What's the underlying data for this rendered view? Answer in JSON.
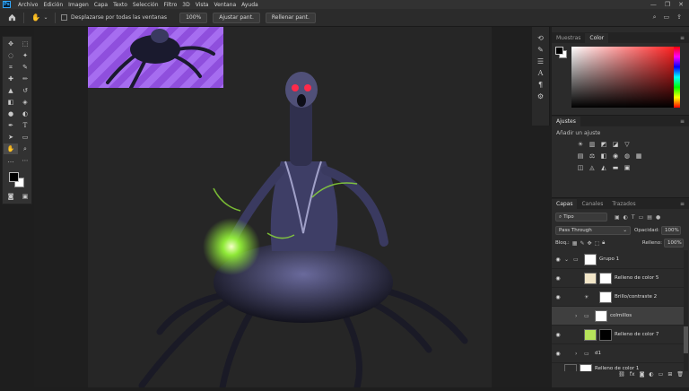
{
  "app": {
    "logo": "Ps"
  },
  "menu": [
    "Archivo",
    "Edición",
    "Imagen",
    "Capa",
    "Texto",
    "Selección",
    "Filtro",
    "3D",
    "Vista",
    "Ventana",
    "Ayuda"
  ],
  "window_controls": [
    "—",
    "❐",
    "✕"
  ],
  "options_bar": {
    "scroll_all_label": "Desplazarse por todas las ventanas",
    "zoom_value": "100%",
    "fit_button": "Ajustar pant.",
    "fill_button": "Rellenar pant."
  },
  "panels": {
    "color_tabs": [
      "Muestras",
      "Color"
    ],
    "adjust_title": "Ajustes",
    "adjust_subtitle": "Añadir un ajuste",
    "layers_tabs": [
      "Capas",
      "Canales",
      "Trazados"
    ],
    "filter_kind": "Tipo",
    "blend_mode": "Pass Through",
    "opacity_label": "Opacidad:",
    "opacity_value": "100%",
    "lock_label": "Bloq.:",
    "fill_label": "Relleno:",
    "fill_value": "100%"
  },
  "layers": [
    {
      "name": "Grupo 1",
      "kind": "group"
    },
    {
      "name": "Relleno de color 5",
      "kind": "fill",
      "thumb": "#f2e6c8"
    },
    {
      "name": "Brillo/contraste 2",
      "kind": "adjust"
    },
    {
      "name": "colmillos",
      "kind": "group",
      "selected": true
    },
    {
      "name": "Relleno de color 7",
      "kind": "fill",
      "thumb": "#b6e35a"
    },
    {
      "name": "d1",
      "kind": "group"
    },
    {
      "name": "Relleno de color 1",
      "kind": "fill",
      "thumb": "#2a2a2a"
    }
  ],
  "colors": {
    "accent_hue": "#ff1e1e",
    "glow": "#9bff3a",
    "thumb_purple": "#9b5ee8"
  }
}
